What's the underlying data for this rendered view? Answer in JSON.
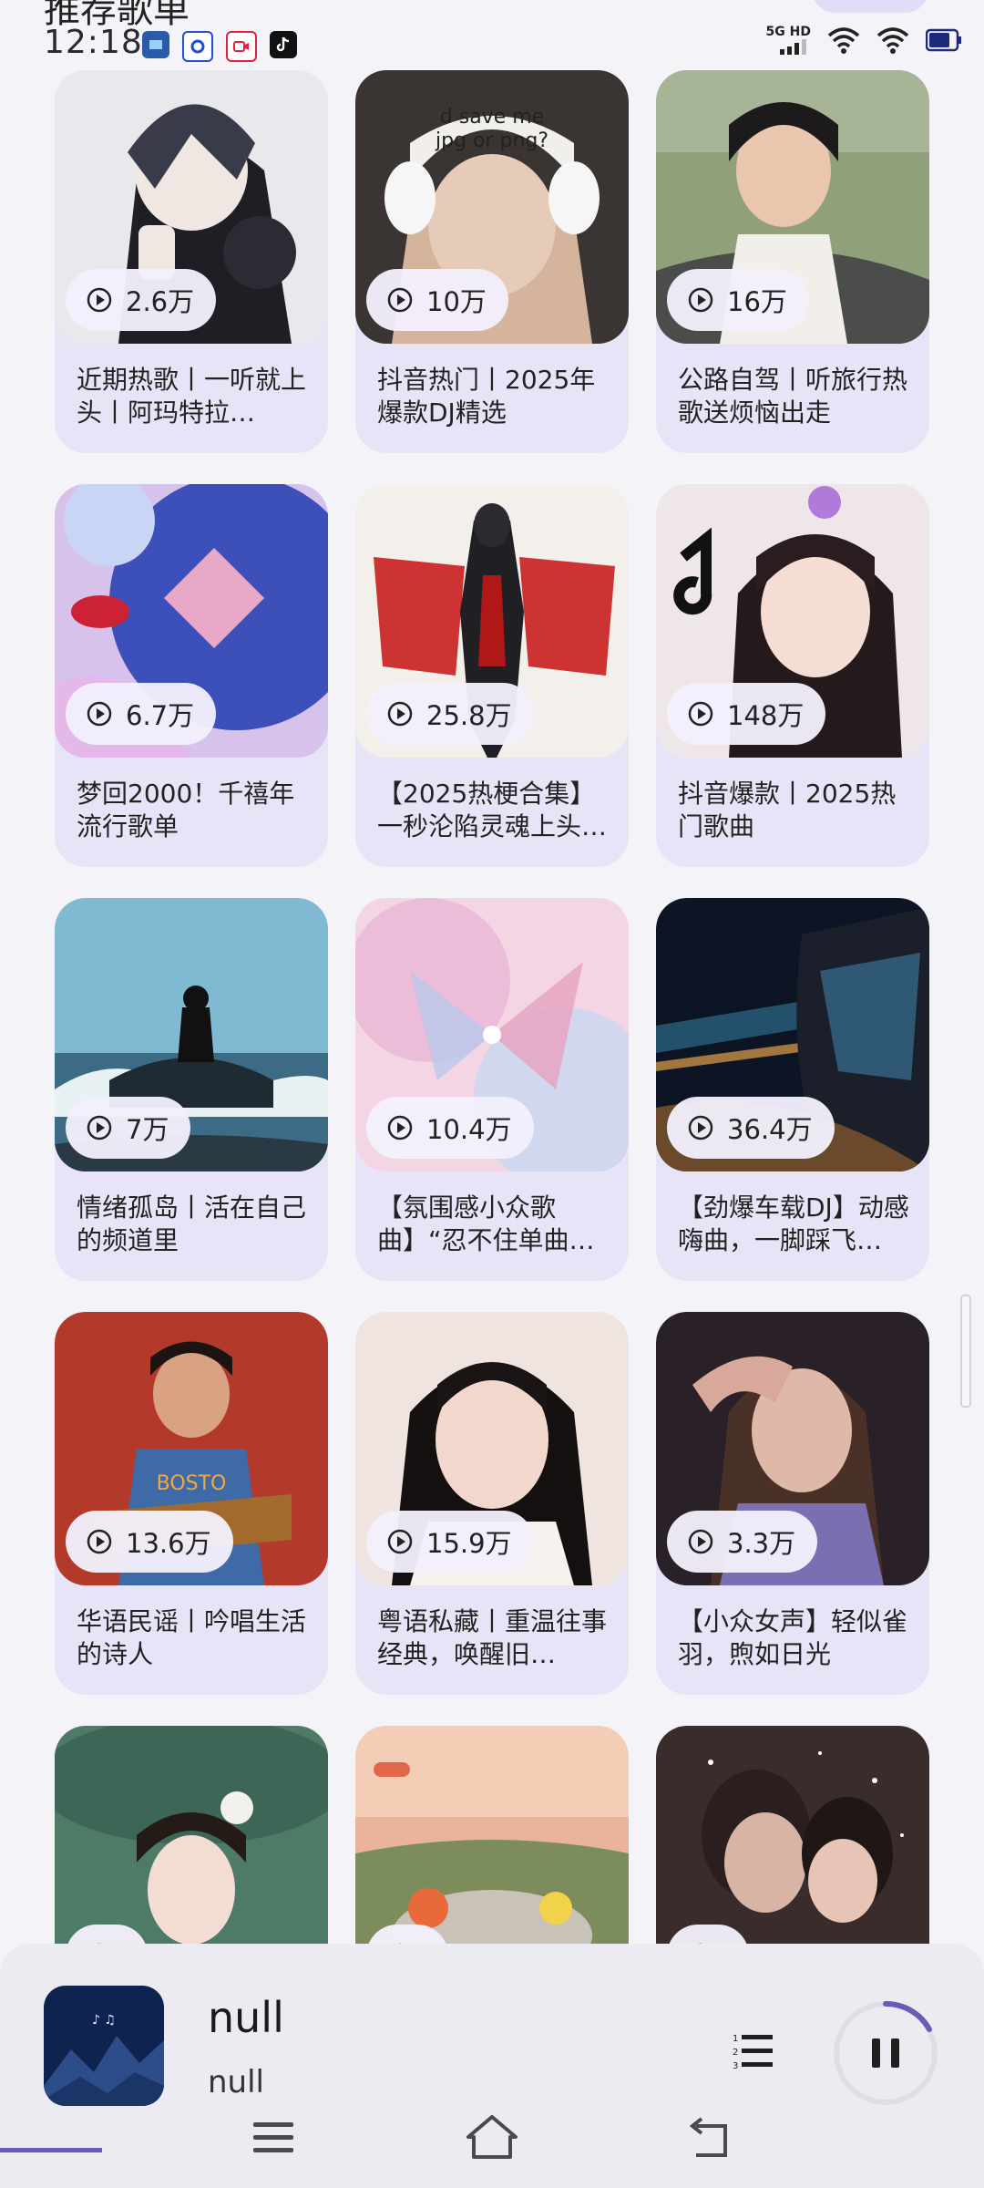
{
  "status_bar": {
    "time": "12:18",
    "network_label": "5G HD"
  },
  "header": {
    "title_cut": "推荐歌单"
  },
  "playlists": [
    {
      "plays": "2.6万",
      "title": "近期热歌丨一听就上头丨阿玛特拉…"
    },
    {
      "plays": "10万",
      "title": "抖音热门丨2025年爆款DJ精选"
    },
    {
      "plays": "16万",
      "title": "公路自驾丨听旅行热歌送烦恼出走"
    },
    {
      "plays": "6.7万",
      "title": "梦回2000！千禧年流行歌单"
    },
    {
      "plays": "25.8万",
      "title": "【2025热梗合集】一秒沦陷灵魂上头…"
    },
    {
      "plays": "148万",
      "title": "抖音爆款丨2025热门歌曲"
    },
    {
      "plays": "7万",
      "title": "情绪孤岛丨活在自己的频道里"
    },
    {
      "plays": "10.4万",
      "title": "【氛围感小众歌曲】“忍不住单曲循…"
    },
    {
      "plays": "36.4万",
      "title": "【劲爆车载DJ】动感嗨曲，一脚踩飞…"
    },
    {
      "plays": "13.6万",
      "title": "华语民谣丨吟唱生活的诗人"
    },
    {
      "plays": "15.9万",
      "title": "粤语私藏丨重温往事经典，唤醒旧…"
    },
    {
      "plays": "3.3万",
      "title": "【小众女声】轻似雀羽，煦如日光"
    },
    {
      "plays": "",
      "title": ""
    },
    {
      "plays": "",
      "title": ""
    },
    {
      "plays": "",
      "title": ""
    }
  ],
  "player": {
    "title": "null",
    "artist": "null"
  },
  "colors": {
    "accent": "#6a5bb5",
    "card_bg": "#e8e4f7",
    "page_bg": "#f4f3f8"
  }
}
